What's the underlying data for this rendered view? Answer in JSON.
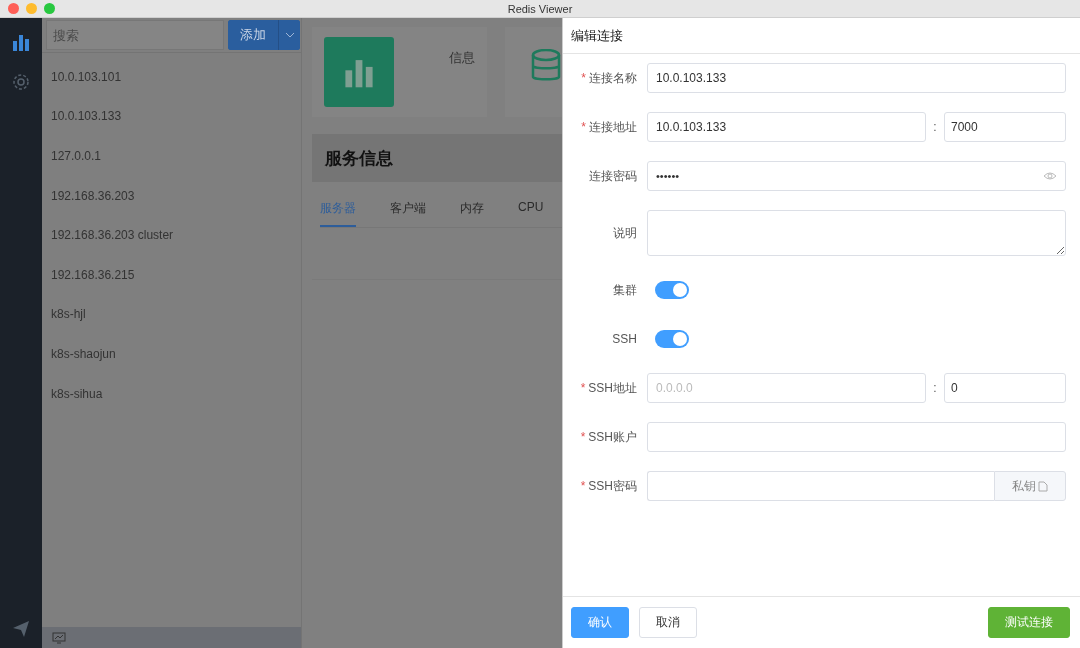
{
  "window": {
    "title": "Redis Viewer"
  },
  "search": {
    "placeholder": "搜索"
  },
  "add_button": {
    "label": "添加"
  },
  "connections": [
    {
      "name": "10.0.103.101"
    },
    {
      "name": "10.0.103.133"
    },
    {
      "name": "127.0.0.1"
    },
    {
      "name": "192.168.36.203"
    },
    {
      "name": "192.168.36.203 cluster"
    },
    {
      "name": "192.168.36.215"
    },
    {
      "name": "k8s-hjl"
    },
    {
      "name": "k8s-shaojun"
    },
    {
      "name": "k8s-sihua"
    }
  ],
  "cards": [
    {
      "label": "信息"
    }
  ],
  "panel": {
    "title": "服务信息",
    "tabs": [
      {
        "label": "服务器",
        "selected": true
      },
      {
        "label": "客户端",
        "selected": false
      },
      {
        "label": "内存",
        "selected": false
      },
      {
        "label": "CPU",
        "selected": false
      }
    ]
  },
  "drawer": {
    "title": "编辑连接",
    "required_mark": "*",
    "fields": [
      {
        "kind": "text",
        "label": "连接名称",
        "required": true,
        "value": "10.0.103.133"
      },
      {
        "kind": "hostport",
        "label": "连接地址",
        "required": true,
        "value": "10.0.103.133",
        "separator": ":",
        "port": "7000"
      },
      {
        "kind": "password",
        "label": "连接密码",
        "required": false,
        "value": "••••••"
      },
      {
        "kind": "textarea",
        "label": "说明",
        "required": false
      },
      {
        "kind": "switch",
        "label": "集群",
        "required": false,
        "on": true
      },
      {
        "kind": "switch",
        "label": "SSH",
        "required": false,
        "on": true
      },
      {
        "kind": "hostport",
        "label": "SSH地址",
        "required": true,
        "placeholder": "0.0.0.0",
        "separator": ":",
        "port": "0"
      },
      {
        "kind": "text",
        "label": "SSH账户",
        "required": true
      },
      {
        "kind": "file",
        "label": "SSH密码",
        "required": true,
        "button": "私钥"
      }
    ],
    "buttons": [
      {
        "kind": "primary",
        "label": "确认"
      },
      {
        "kind": "default",
        "label": "取消"
      },
      {
        "kind": "success",
        "label": "测试连接"
      }
    ]
  }
}
